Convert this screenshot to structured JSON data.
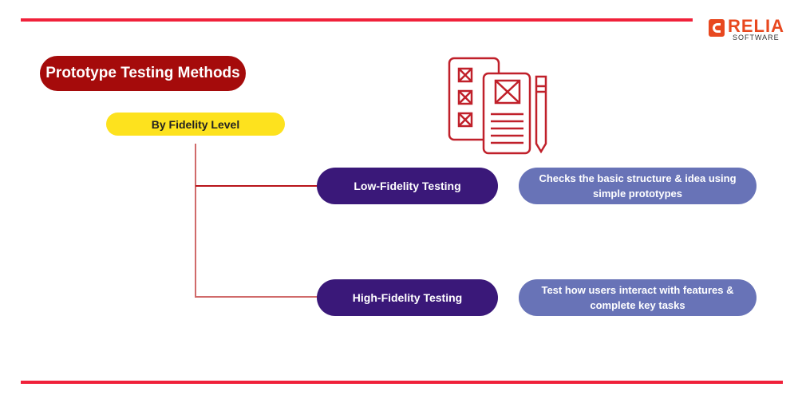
{
  "logo": {
    "name": "RELIA",
    "sub": "SOFTWARE"
  },
  "title": "Prototype Testing Methods",
  "category": "By Fidelity Level",
  "methods": [
    {
      "label": "Low-Fidelity Testing",
      "description": "Checks the basic structure & idea using simple prototypes"
    },
    {
      "label": "High-Fidelity Testing",
      "description": "Test how users interact with features & complete key tasks"
    }
  ],
  "colors": {
    "accent_red": "#f0213a",
    "title_bg": "#a50b0b",
    "category_bg": "#fde21e",
    "method_bg": "#3a1879",
    "description_bg": "#6873b7",
    "icon_color": "#c0202a",
    "logo_color": "#e8481f"
  },
  "icon": "prototype-wireframe-documents-pencil-icon"
}
